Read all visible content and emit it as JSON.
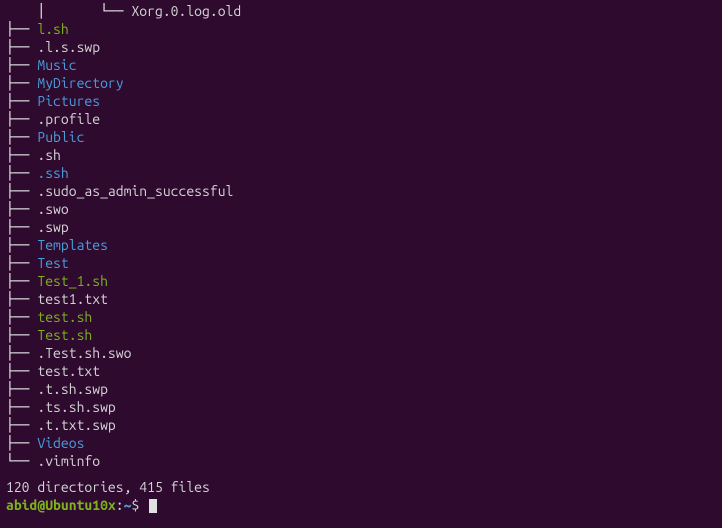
{
  "tree": {
    "deep_prefix": "    │       └── ",
    "entries": [
      {
        "prefix": "child",
        "name": "Xorg.0.log.old",
        "color": "plain"
      },
      {
        "prefix": "mid",
        "name": "l.sh",
        "color": "green"
      },
      {
        "prefix": "mid",
        "name": ".l.s.swp",
        "color": "plain"
      },
      {
        "prefix": "mid",
        "name": "Music",
        "color": "blue"
      },
      {
        "prefix": "mid",
        "name": "MyDirectory",
        "color": "blue"
      },
      {
        "prefix": "mid",
        "name": "Pictures",
        "color": "blue"
      },
      {
        "prefix": "mid",
        "name": ".profile",
        "color": "plain"
      },
      {
        "prefix": "mid",
        "name": "Public",
        "color": "blue"
      },
      {
        "prefix": "mid",
        "name": ".sh",
        "color": "plain"
      },
      {
        "prefix": "mid",
        "name": ".ssh",
        "color": "blue"
      },
      {
        "prefix": "mid",
        "name": ".sudo_as_admin_successful",
        "color": "plain"
      },
      {
        "prefix": "mid",
        "name": ".swo",
        "color": "plain"
      },
      {
        "prefix": "mid",
        "name": ".swp",
        "color": "plain"
      },
      {
        "prefix": "mid",
        "name": "Templates",
        "color": "blue"
      },
      {
        "prefix": "mid",
        "name": "Test",
        "color": "blue"
      },
      {
        "prefix": "mid",
        "name": "Test_1.sh",
        "color": "green"
      },
      {
        "prefix": "mid",
        "name": "test1.txt",
        "color": "plain"
      },
      {
        "prefix": "mid",
        "name": "test.sh",
        "color": "green"
      },
      {
        "prefix": "mid",
        "name": "Test.sh",
        "color": "green"
      },
      {
        "prefix": "mid",
        "name": ".Test.sh.swo",
        "color": "plain"
      },
      {
        "prefix": "mid",
        "name": "test.txt",
        "color": "plain"
      },
      {
        "prefix": "mid",
        "name": ".t.sh.swp",
        "color": "plain"
      },
      {
        "prefix": "mid",
        "name": ".ts.sh.swp",
        "color": "plain"
      },
      {
        "prefix": "mid",
        "name": ".t.txt.swp",
        "color": "plain"
      },
      {
        "prefix": "mid",
        "name": "Videos",
        "color": "blue"
      },
      {
        "prefix": "last",
        "name": ".viminfo",
        "color": "plain"
      }
    ]
  },
  "summary": "120 directories, 415 files",
  "prompt": {
    "user": "abid@Ubuntu10x",
    "colon": ":",
    "path": "~",
    "dollar": "$"
  },
  "prefixes": {
    "child": "    │       └── ",
    "mid": "├── ",
    "last": "└── "
  }
}
